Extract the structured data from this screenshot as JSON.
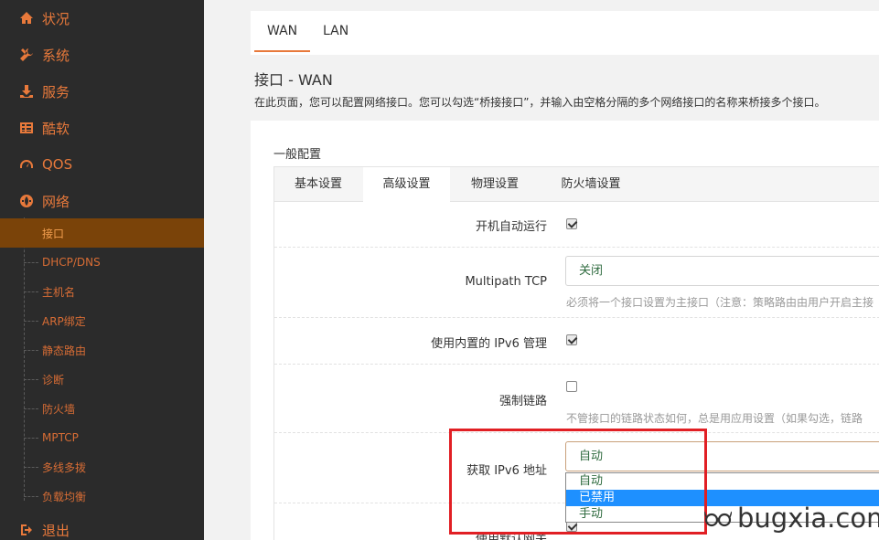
{
  "sidebar": {
    "items": [
      {
        "label": "状况",
        "icon": "home-icon"
      },
      {
        "label": "系统",
        "icon": "tools-icon"
      },
      {
        "label": "服务",
        "icon": "download-icon"
      },
      {
        "label": "酷软",
        "icon": "grid-icon"
      },
      {
        "label": "QOS",
        "icon": "speed-gauge-icon"
      },
      {
        "label": "网络",
        "icon": "globe-icon"
      }
    ],
    "sub_items": [
      "接口",
      "DHCP/DNS",
      "主机名",
      "ARP绑定",
      "静态路由",
      "诊断",
      "防火墙",
      "MPTCP",
      "多线多拨",
      "负载均衡"
    ],
    "active_sub": "接口",
    "logout": {
      "label": "退出",
      "icon": "logout-icon"
    }
  },
  "top_tabs": [
    {
      "label": "WAN"
    },
    {
      "label": "LAN"
    }
  ],
  "page": {
    "title": "接口 - WAN",
    "description": "在此页面，您可以配置网络接口。您可以勾选“桥接接口”，并输入由空格分隔的多个网络接口的名称来桥接多个接口。"
  },
  "section_title": "一般配置",
  "sub_tabs": [
    {
      "label": "基本设置"
    },
    {
      "label": "高级设置"
    },
    {
      "label": "物理设置"
    },
    {
      "label": "防火墙设置"
    }
  ],
  "form": {
    "autostart": {
      "label": "开机自动运行",
      "checked": true
    },
    "multipath": {
      "label": "Multipath TCP",
      "value": "关闭",
      "hint": "必须将一个接口设置为主接口（注意：策略路由由用户开启主接"
    },
    "ipv6_builtin": {
      "label": "使用内置的 IPv6 管理",
      "checked": true
    },
    "force_link": {
      "label": "强制链路",
      "checked": false,
      "hint": "不管接口的链路状态如何，总是用应用设置（如果勾选，链路"
    },
    "ipv6_addr": {
      "label": "获取 IPv6 地址",
      "value": "自动",
      "options": [
        "自动",
        "已禁用",
        "手动"
      ],
      "highlighted": "已禁用"
    },
    "default_gw": {
      "label": "使用默认网关",
      "checked": true
    }
  },
  "watermark": "bugxia.com",
  "colors": {
    "accent": "#e8793b",
    "sidebar_bg": "#2b2b2b",
    "active_bg": "#7a4309",
    "highlight": "#1e90ff",
    "annotation": "#e11f24"
  }
}
